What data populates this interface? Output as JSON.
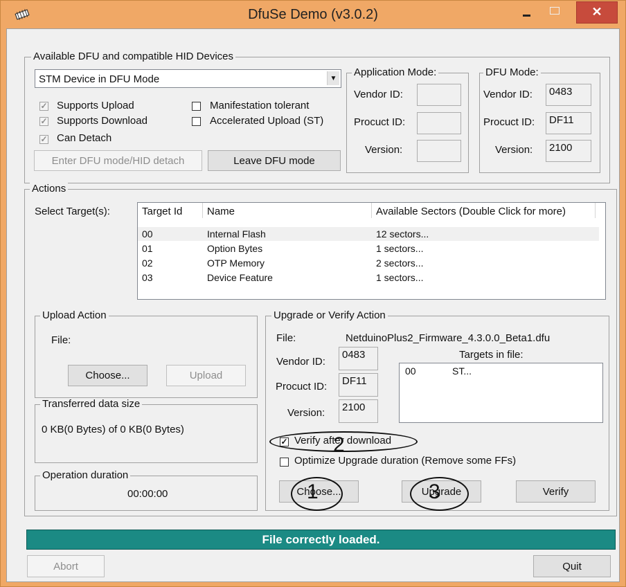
{
  "window": {
    "title": "DfuSe Demo (v3.0.2)",
    "close_glyph": "✕"
  },
  "devices": {
    "legend": "Available DFU and compatible HID Devices",
    "selected_device": "STM Device in DFU Mode",
    "checkboxes": {
      "supports_upload": {
        "label": "Supports Upload",
        "checked": true
      },
      "supports_download": {
        "label": "Supports Download",
        "checked": true
      },
      "can_detach": {
        "label": "Can Detach",
        "checked": true
      },
      "manifestation_tolerant": {
        "label": "Manifestation tolerant",
        "checked": false
      },
      "accelerated_upload": {
        "label": "Accelerated Upload (ST)",
        "checked": false
      }
    },
    "enter_dfu_button": "Enter DFU mode/HID detach",
    "leave_dfu_button": "Leave DFU mode"
  },
  "app_mode": {
    "legend": "Application Mode:",
    "vendor_id_label": "Vendor ID:",
    "product_id_label": "Procuct ID:",
    "version_label": "Version:",
    "vendor_id": "",
    "product_id": "",
    "version": ""
  },
  "dfu_mode": {
    "legend": "DFU Mode:",
    "vendor_id_label": "Vendor ID:",
    "product_id_label": "Procuct ID:",
    "version_label": "Version:",
    "vendor_id": "0483",
    "product_id": "DF11",
    "version": "2100"
  },
  "actions": {
    "legend": "Actions",
    "select_target_label": "Select Target(s):",
    "columns": [
      "Target Id",
      "Name",
      "Available Sectors (Double Click for more)"
    ],
    "targets": [
      {
        "id": "00",
        "name": "Internal Flash",
        "sectors": "12 sectors..."
      },
      {
        "id": "01",
        "name": "Option Bytes",
        "sectors": "1 sectors..."
      },
      {
        "id": "02",
        "name": "OTP Memory",
        "sectors": "2 sectors..."
      },
      {
        "id": "03",
        "name": "Device Feature",
        "sectors": "1 sectors..."
      }
    ]
  },
  "upload_action": {
    "legend": "Upload Action",
    "file_label": "File:",
    "choose_button": "Choose...",
    "upload_button": "Upload"
  },
  "transferred": {
    "legend": "Transferred data size",
    "value": "0 KB(0 Bytes) of 0 KB(0 Bytes)"
  },
  "operation": {
    "legend": "Operation duration",
    "value": "00:00:00"
  },
  "upgrade_action": {
    "legend": "Upgrade or Verify Action",
    "file_label": "File:",
    "file_name": "NetduinoPlus2_Firmware_4.3.0.0_Beta1.dfu",
    "vendor_id_label": "Vendor ID:",
    "product_id_label": "Procuct ID:",
    "version_label": "Version:",
    "vendor_id": "0483",
    "product_id": "DF11",
    "version": "2100",
    "targets_in_file_label": "Targets in file:",
    "targets_in_file": [
      {
        "id": "00",
        "name": "ST..."
      }
    ],
    "verify_after_download": {
      "label": "Verify after download",
      "checked": true
    },
    "optimize_upgrade": {
      "label": "Optimize Upgrade duration (Remove some FFs)",
      "checked": false
    },
    "choose_button": "Choose...",
    "upgrade_button": "Upgrade",
    "verify_button": "Verify"
  },
  "annotations": [
    "1",
    "2",
    "3"
  ],
  "status": "File correctly loaded.",
  "abort_button": "Abort",
  "quit_button": "Quit",
  "colors": {
    "titlebar": "#f0a866",
    "close_button": "#c74b3c",
    "status_bar": "#1b8a84"
  }
}
